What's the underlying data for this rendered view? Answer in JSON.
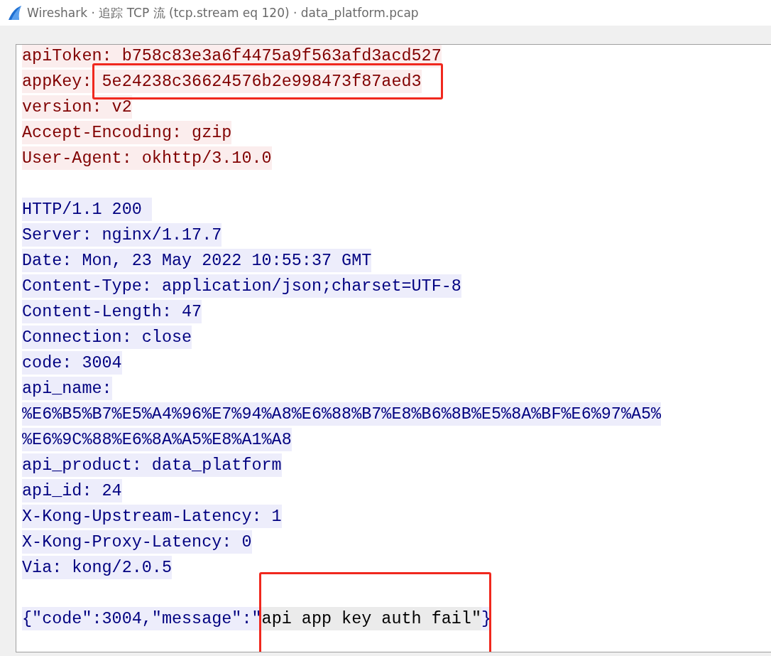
{
  "window": {
    "title": "Wireshark · 追踪 TCP 流 (tcp.stream eq 120) · data_platform.pcap"
  },
  "stream": {
    "lines": [
      {
        "kind": "client",
        "segments": [
          {
            "text": "apiToken: b758c83e3a6f4475a9f563afd3acd527"
          }
        ]
      },
      {
        "kind": "client",
        "segments": [
          {
            "text": "appKey: "
          },
          {
            "text": "5e24238c36624576b2e998473f87aed3",
            "boxed": true
          }
        ]
      },
      {
        "kind": "client",
        "segments": [
          {
            "text": "version: v2"
          }
        ]
      },
      {
        "kind": "client",
        "segments": [
          {
            "text": "Accept-Encoding: gzip"
          }
        ]
      },
      {
        "kind": "client",
        "segments": [
          {
            "text": "User-Agent: okhttp/3.10.0"
          }
        ]
      },
      {
        "kind": "blank"
      },
      {
        "kind": "server",
        "segments": [
          {
            "text": "HTTP/1.1 200 "
          }
        ]
      },
      {
        "kind": "server",
        "segments": [
          {
            "text": "Server: nginx/1.17.7"
          }
        ]
      },
      {
        "kind": "server",
        "segments": [
          {
            "text": "Date: Mon, 23 May 2022 10:55:37 GMT"
          }
        ]
      },
      {
        "kind": "server",
        "segments": [
          {
            "text": "Content-Type: application/json;charset=UTF-8"
          }
        ]
      },
      {
        "kind": "server",
        "segments": [
          {
            "text": "Content-Length: 47"
          }
        ]
      },
      {
        "kind": "server",
        "segments": [
          {
            "text": "Connection: close"
          }
        ]
      },
      {
        "kind": "server",
        "segments": [
          {
            "text": "code: 3004"
          }
        ]
      },
      {
        "kind": "server",
        "segments": [
          {
            "text": "api_name:"
          }
        ]
      },
      {
        "kind": "server",
        "segments": [
          {
            "text": "%E6%B5%B7%E5%A4%96%E7%94%A8%E6%88%B7%E8%B6%8B%E5%8A%BF%E6%97%A5%"
          }
        ]
      },
      {
        "kind": "server",
        "segments": [
          {
            "text": "%E6%9C%88%E6%8A%A5%E8%A1%A8"
          }
        ]
      },
      {
        "kind": "server",
        "segments": [
          {
            "text": "api_product: data_platform"
          }
        ]
      },
      {
        "kind": "server",
        "segments": [
          {
            "text": "api_id: 24"
          }
        ]
      },
      {
        "kind": "server",
        "segments": [
          {
            "text": "X-Kong-Upstream-Latency: 1"
          }
        ]
      },
      {
        "kind": "server",
        "segments": [
          {
            "text": "X-Kong-Proxy-Latency: 0"
          }
        ]
      },
      {
        "kind": "server",
        "segments": [
          {
            "text": "Via: kong/2.0.5"
          }
        ]
      },
      {
        "kind": "blank"
      },
      {
        "kind": "server",
        "segments": [
          {
            "text": "{\"code\":3004,\"message\":\""
          },
          {
            "text": "api app key auth fail\"",
            "highlighted": true,
            "boxed": true
          },
          {
            "text": "}"
          }
        ]
      }
    ]
  }
}
